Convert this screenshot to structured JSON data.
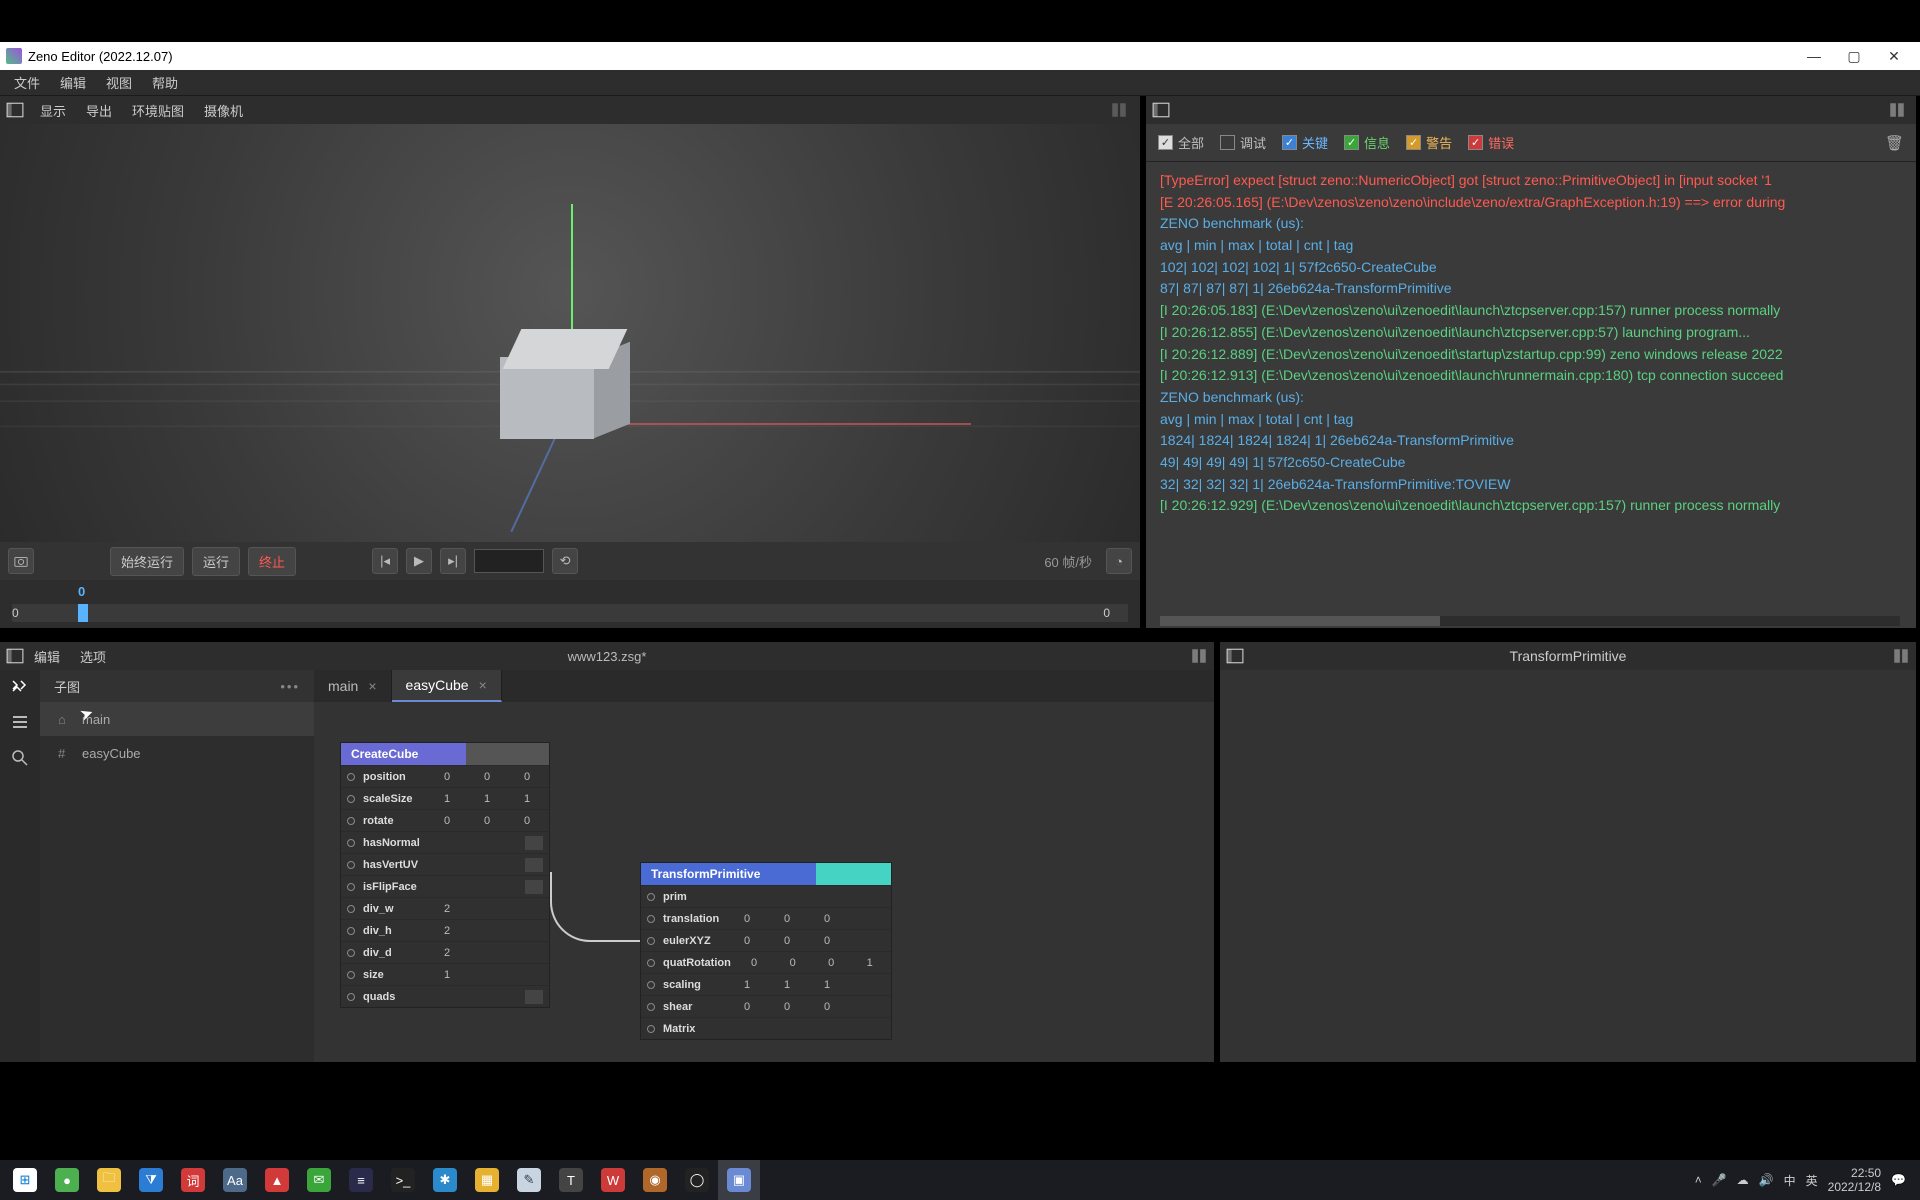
{
  "window": {
    "title": "Zeno Editor (2022.12.07)"
  },
  "menubar": [
    "文件",
    "编辑",
    "视图",
    "帮助"
  ],
  "vp_toolbar": [
    "显示",
    "导出",
    "环境贴图",
    "摄像机"
  ],
  "transport": {
    "always_run": "始终运行",
    "run": "运行",
    "stop": "终止",
    "fps": "60 帧/秒"
  },
  "timeline": {
    "current": "0",
    "start": "0",
    "end": "0"
  },
  "log": {
    "filters": {
      "all": "全部",
      "debug": "调试",
      "key": "关键",
      "info": "信息",
      "warn": "警告",
      "error": "错误"
    },
    "lines": [
      {
        "cls": "l-red",
        "t": "[TypeError] expect [struct zeno::NumericObject] got [struct zeno::PrimitiveObject] in [input socket '1"
      },
      {
        "cls": "l-red",
        "t": "[E 20:26:05.165] (E:\\Dev\\zenos\\zeno\\zeno\\include\\zeno/extra/GraphException.h:19) ==> error during"
      },
      {
        "cls": "l-blue",
        "t": "ZENO benchmark (us):"
      },
      {
        "cls": "l-blue",
        "t": "      avg   |   min   |   max   |   total  | cnt | tag"
      },
      {
        "cls": "l-blue",
        "t": "       102|      102|      102|      102|     1| 57f2c650-CreateCube"
      },
      {
        "cls": "l-blue",
        "t": "        87|       87|       87|       87|     1| 26eb624a-TransformPrimitive"
      },
      {
        "cls": "l-green",
        "t": "[I 20:26:05.183] (E:\\Dev\\zenos\\zeno\\ui\\zenoedit\\launch\\ztcpserver.cpp:157) runner process normally"
      },
      {
        "cls": "l-green",
        "t": "[I 20:26:12.855] (E:\\Dev\\zenos\\zeno\\ui\\zenoedit\\launch\\ztcpserver.cpp:57) launching program..."
      },
      {
        "cls": "l-green",
        "t": "[I 20:26:12.889] (E:\\Dev\\zenos\\zeno\\ui\\zenoedit\\startup\\zstartup.cpp:99) zeno windows release 2022"
      },
      {
        "cls": "l-green",
        "t": "[I 20:26:12.913] (E:\\Dev\\zenos\\zeno\\ui\\zenoedit\\launch\\runnermain.cpp:180) tcp connection succeed"
      },
      {
        "cls": "l-blue",
        "t": "ZENO benchmark (us):"
      },
      {
        "cls": "l-blue",
        "t": "      avg   |   min   |   max   |   total  | cnt | tag"
      },
      {
        "cls": "l-blue",
        "t": "      1824|     1824|     1824|     1824|     1| 26eb624a-TransformPrimitive"
      },
      {
        "cls": "l-blue",
        "t": "        49|       49|       49|       49|     1| 57f2c650-CreateCube"
      },
      {
        "cls": "l-blue",
        "t": "        32|       32|       32|       32|     1| 26eb624a-TransformPrimitive:TOVIEW"
      },
      {
        "cls": "l-green",
        "t": "[I 20:26:12.929] (E:\\Dev\\zenos\\zeno\\ui\\zenoedit\\launch\\ztcpserver.cpp:157) runner process normally"
      }
    ]
  },
  "ned": {
    "menu": [
      "编辑",
      "选项"
    ],
    "file": "www123.zsg*",
    "tree_title": "子图",
    "tree": [
      {
        "glyph": "⌂",
        "label": "main"
      },
      {
        "glyph": "#",
        "label": "easyCube"
      }
    ],
    "tabs": [
      {
        "label": "main",
        "active": false
      },
      {
        "label": "easyCube",
        "active": true
      }
    ]
  },
  "nodes": {
    "createCube": {
      "title": "CreateCube",
      "params": [
        {
          "name": "position",
          "v": [
            "0",
            "0",
            "0"
          ]
        },
        {
          "name": "scaleSize",
          "v": [
            "1",
            "1",
            "1"
          ]
        },
        {
          "name": "rotate",
          "v": [
            "0",
            "0",
            "0"
          ]
        },
        {
          "name": "hasNormal",
          "slot": true
        },
        {
          "name": "hasVertUV",
          "slot": true
        },
        {
          "name": "isFlipFace",
          "slot": true
        },
        {
          "name": "div_w",
          "v": [
            "2"
          ]
        },
        {
          "name": "div_h",
          "v": [
            "2"
          ]
        },
        {
          "name": "div_d",
          "v": [
            "2"
          ]
        },
        {
          "name": "size",
          "v": [
            "1"
          ]
        },
        {
          "name": "quads",
          "slot": true
        }
      ]
    },
    "transformPrimitive": {
      "title": "TransformPrimitive",
      "params": [
        {
          "name": "prim"
        },
        {
          "name": "translation",
          "v": [
            "0",
            "0",
            "0"
          ]
        },
        {
          "name": "eulerXYZ",
          "v": [
            "0",
            "0",
            "0"
          ]
        },
        {
          "name": "quatRotation",
          "v": [
            "0",
            "0",
            "0",
            "1"
          ]
        },
        {
          "name": "scaling",
          "v": [
            "1",
            "1",
            "1"
          ]
        },
        {
          "name": "shear",
          "v": [
            "0",
            "0",
            "0"
          ]
        },
        {
          "name": "Matrix"
        }
      ]
    }
  },
  "prop": {
    "title": "TransformPrimitive"
  },
  "tray": {
    "ime1": "中",
    "ime2": "英",
    "time": "22:50",
    "date": "2022/12/8"
  }
}
